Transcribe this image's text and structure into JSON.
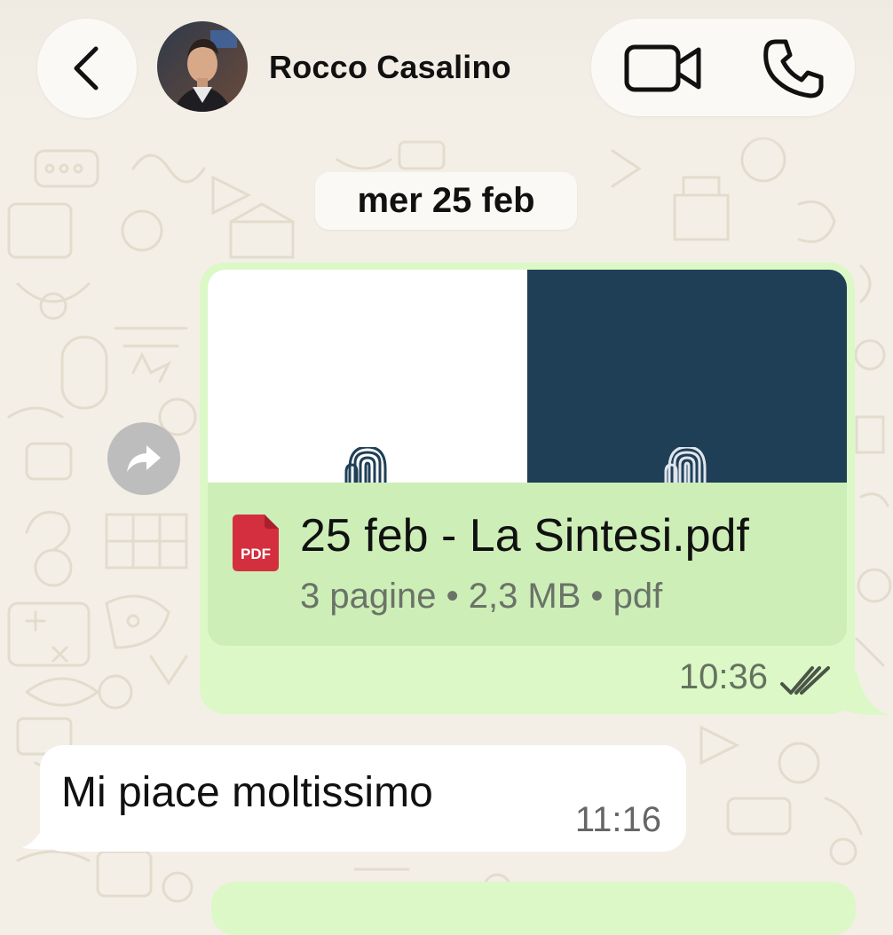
{
  "header": {
    "contact_name": "Rocco Casalino",
    "back_icon": "chevron-left-icon",
    "video_call_icon": "video-camera-icon",
    "voice_call_icon": "phone-icon"
  },
  "chat": {
    "date_separator": "mer 25 feb",
    "messages": [
      {
        "direction": "outgoing",
        "type": "document",
        "document": {
          "filename": "25 feb - La Sintesi.pdf",
          "meta": "3 pagine • 2,3 MB • pdf",
          "icon_label": "PDF"
        },
        "time": "10:36",
        "status": "read"
      },
      {
        "direction": "incoming",
        "type": "text",
        "text": "Mi piace moltissimo",
        "time": "11:16"
      }
    ]
  },
  "colors": {
    "background": "#f3efe7",
    "outgoing_bubble": "#dcf8c6",
    "incoming_bubble": "#ffffff",
    "document_card": "#cdeeb7",
    "preview_dark": "#1f3f57",
    "pdf_red": "#d32f2f"
  }
}
